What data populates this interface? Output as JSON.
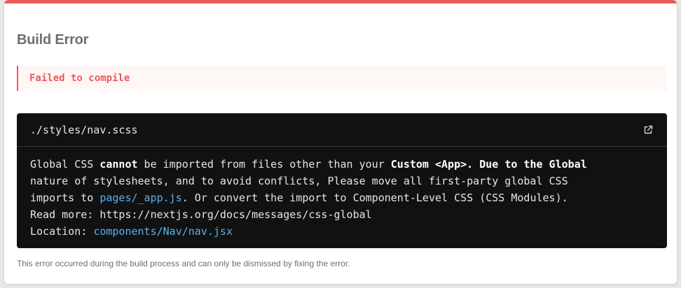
{
  "dialog": {
    "accent_color": "#ea5b5b",
    "title": "Build Error",
    "banner": "Failed to compile",
    "file": {
      "path": "./styles/nav.scss",
      "open_icon": "external-link-icon"
    },
    "message": {
      "l1_a": "Global CSS ",
      "l1_b": "cannot",
      "l1_c": " be imported from files other than your ",
      "l1_d": "Custom <App>",
      "l1_e": ". Due to the Global",
      "l2": "nature of stylesheets, and to avoid conflicts, Please move all first-party global CSS",
      "l3_a": "imports to ",
      "l3_link": "pages/_app.js",
      "l3_b": ". Or convert the import to Component-Level CSS (CSS Modules).",
      "l4": "Read more: https://nextjs.org/docs/messages/css-global",
      "l5_a": "Location: ",
      "l5_link": "components/Nav/nav.jsx"
    },
    "footer": "This error occurred during the build process and can only be dismissed by fixing the error."
  }
}
